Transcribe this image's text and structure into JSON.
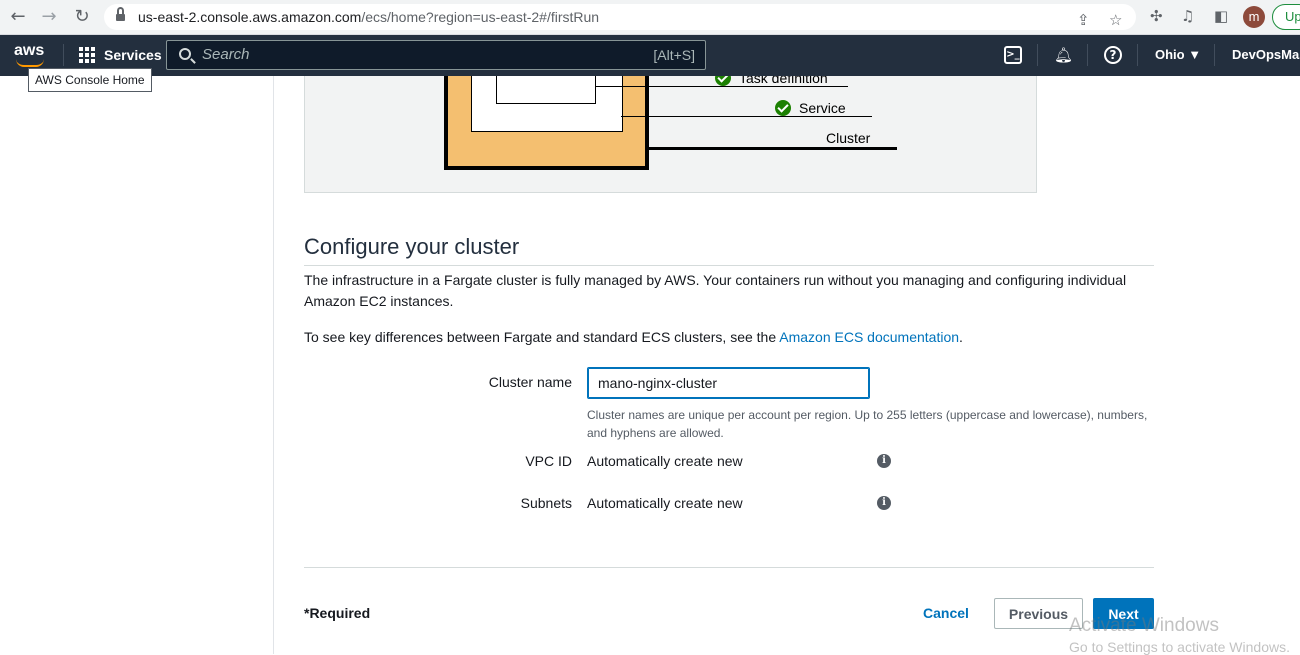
{
  "browser": {
    "back_icon": "←",
    "forward_icon": "→",
    "reload_icon": "↻",
    "url_host": "us-east-2.console.aws.amazon.com",
    "url_path": "/ecs/home?region=us-east-2#/firstRun",
    "profile_initial": "m",
    "update_label": "Up"
  },
  "aws_nav": {
    "logo_text": "aws",
    "services_label": "Services",
    "search_placeholder": "Search",
    "search_shortcut": "[Alt+S]",
    "region": "Ohio ▼",
    "account": "DevOpsMast",
    "tooltip": "AWS Console Home"
  },
  "diagram": {
    "labels": [
      "Task definition",
      "Service",
      "Cluster"
    ]
  },
  "configure": {
    "title": "Configure your cluster",
    "description": "The infrastructure in a Fargate cluster is fully managed by AWS. Your containers run without you managing and configuring individual Amazon EC2 instances.",
    "docs_prefix": "To see key differences between Fargate and standard ECS clusters, see the ",
    "docs_link": "Amazon ECS documentation",
    "docs_suffix": ".",
    "cluster_name_label": "Cluster name",
    "cluster_name_value": "mano-nginx-cluster",
    "cluster_name_hint": "Cluster names are unique per account per region. Up to 255 letters (uppercase and lowercase), numbers, and hyphens are allowed.",
    "vpc_label": "VPC ID",
    "vpc_value": "Automatically create new",
    "subnets_label": "Subnets",
    "subnets_value": "Automatically create new"
  },
  "footer": {
    "required": "*Required",
    "cancel": "Cancel",
    "previous": "Previous",
    "next": "Next"
  },
  "watermark": {
    "line1": "Activate Windows",
    "line2": "Go to Settings to activate Windows."
  }
}
